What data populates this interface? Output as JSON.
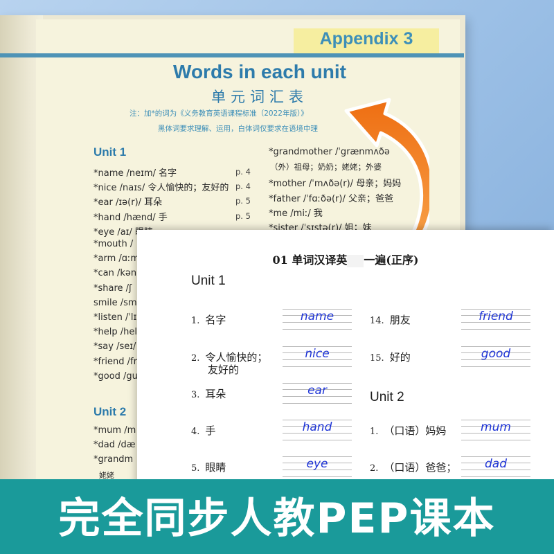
{
  "appendix": {
    "tab_label": "Appendix 3",
    "title": "Words in each unit",
    "subtitle": "单元词汇表",
    "note_line1": "注：加*的词为《义务教育英语课程标准（2022年版）》",
    "note_line2": "黑体词要求理解、运用，白体词仅要求在语境中理"
  },
  "back_page": {
    "unit1_heading": "Unit 1",
    "unit2_heading": "Unit 2",
    "left_column": [
      {
        "text": "*name /neɪm/ 名字",
        "page": "p. 4"
      },
      {
        "text": "*nice /naɪs/ 令人愉快的；友好的",
        "page": "p. 4"
      },
      {
        "text": "*ear /ɪə(r)/ 耳朵",
        "page": "p. 5"
      },
      {
        "text": "*hand /hænd/ 手",
        "page": "p. 5"
      },
      {
        "text": "*eye /aɪ/ 眼睛",
        "page": ""
      },
      {
        "text": "*mouth /",
        "page": ""
      },
      {
        "text": "*arm /ɑːm",
        "page": ""
      },
      {
        "text": "*can /kən,",
        "page": ""
      },
      {
        "text": "*share /ʃ",
        "page": ""
      },
      {
        "text": "smile /sm",
        "page": ""
      },
      {
        "text": "*listen /ˈlɪ",
        "page": ""
      },
      {
        "text": "*help /hel",
        "page": ""
      },
      {
        "text": "*say /seɪ/",
        "page": ""
      },
      {
        "text": "*friend /fr",
        "page": ""
      },
      {
        "text": "*good /gu",
        "page": ""
      }
    ],
    "unit2_rows": [
      {
        "text": "*mum /m"
      },
      {
        "text": "*dad /dæ"
      },
      {
        "text": "*grandm"
      },
      {
        "text": "姥姥"
      }
    ],
    "right_column": [
      {
        "text": "*grandmother /ˈgrænmʌðə"
      },
      {
        "text": "（外）祖母；奶奶；姥姥；外婆"
      },
      {
        "text": "*mother /ˈmʌðə(r)/ 母亲；妈妈"
      },
      {
        "text": "*father /ˈfɑːðə(r)/ 父亲；爸爸"
      },
      {
        "text": "*me /miː/ 我"
      },
      {
        "text": "*sister /ˈsɪstə(r)/ 姐；妹"
      }
    ]
  },
  "worksheet": {
    "title_left": "01 单词汉译英",
    "title_right": "一遍(正序)",
    "unit1_heading": "Unit 1",
    "unit2_heading": "Unit 2",
    "unit1_items": [
      {
        "num": "1.",
        "cn": "名字",
        "en": "name"
      },
      {
        "num": "2.",
        "cn": "令人愉快的；",
        "cn2": "友好的",
        "en": "nice"
      },
      {
        "num": "3.",
        "cn": "耳朵",
        "en": "ear"
      },
      {
        "num": "4.",
        "cn": "手",
        "en": "hand"
      },
      {
        "num": "5.",
        "cn": "眼睛",
        "en": "eye"
      }
    ],
    "unit1_right_items": [
      {
        "num": "14.",
        "cn": "朋友",
        "en": "friend"
      },
      {
        "num": "15.",
        "cn": "好的",
        "en": "good"
      }
    ],
    "unit2_items": [
      {
        "num": "1.",
        "cn": "（口语）妈妈",
        "en": "mum"
      },
      {
        "num": "2.",
        "cn": "（口语）爸爸；",
        "en": "dad"
      }
    ]
  },
  "banner": {
    "text": "完全同步人教PEP课本",
    "color": "#1a9a9a"
  },
  "colors": {
    "accent_blue": "#2d7bab",
    "arrow_orange": "#f07a1e",
    "answer_ink": "#1f35d6"
  }
}
